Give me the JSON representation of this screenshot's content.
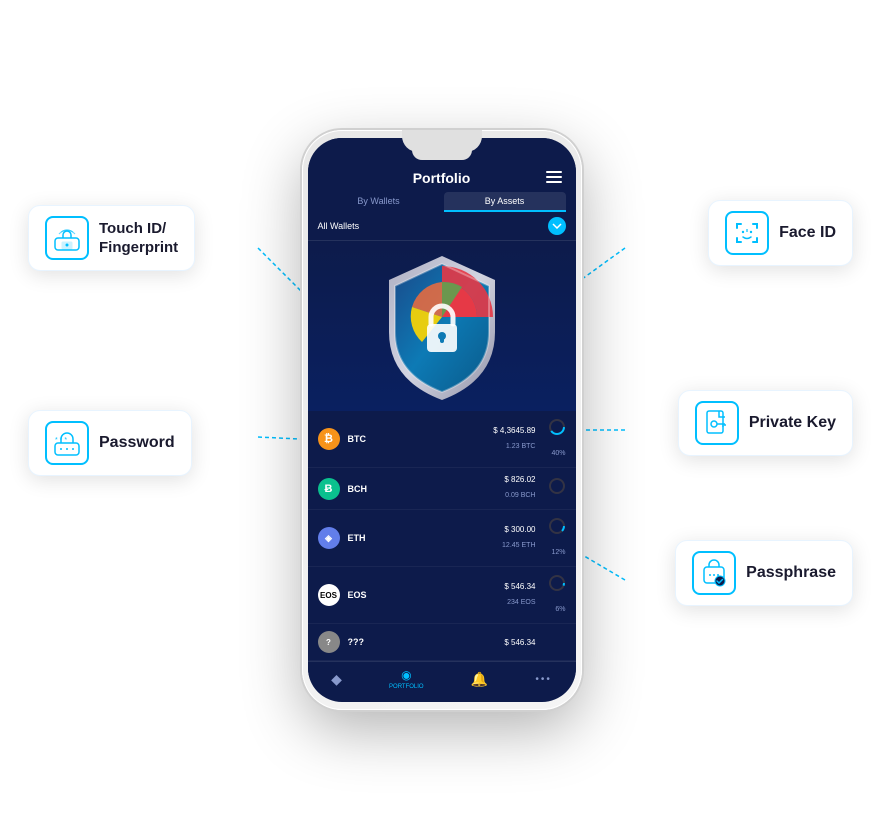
{
  "app": {
    "title": "Portfolio",
    "menu_icon": "☰"
  },
  "tabs": [
    {
      "label": "By Wallets",
      "active": false
    },
    {
      "label": "By Assets",
      "active": true
    }
  ],
  "wallet_selector": {
    "label": "All Wallets",
    "dropdown_icon": "▾"
  },
  "portfolio_items": [
    {
      "symbol": "BTC",
      "icon_type": "btc",
      "usd": "$ 4,3645.89",
      "amount": "1.23 BTC",
      "pct": "40%"
    },
    {
      "symbol": "BCH",
      "icon_type": "bch",
      "usd": "$ 826.02",
      "amount": "0.09 BCH",
      "pct": ""
    },
    {
      "symbol": "ETH",
      "icon_type": "eth",
      "usd": "$ 300.00",
      "amount": "12.45 ETH",
      "pct": "12%"
    },
    {
      "symbol": "EOS",
      "icon_type": "eos",
      "usd": "$ 546.34",
      "amount": "234 EOS",
      "pct": "6%"
    },
    {
      "symbol": "???",
      "icon_type": "other",
      "usd": "$ 546.34",
      "amount": "",
      "pct": ""
    }
  ],
  "bottom_nav": [
    {
      "label": "",
      "icon": "◆",
      "active": false
    },
    {
      "label": "PORTFOLIO",
      "icon": "◉",
      "active": true
    },
    {
      "label": "",
      "icon": "🔔",
      "active": false
    },
    {
      "label": "",
      "icon": "•••",
      "active": false
    }
  ],
  "features": {
    "touch_id": {
      "label": "Touch ID/\nFingerprint",
      "icon": "fingerprint"
    },
    "face_id": {
      "label": "Face ID",
      "icon": "face"
    },
    "password": {
      "label": "Password",
      "icon": "password"
    },
    "private_key": {
      "label": "Private Key",
      "icon": "key"
    },
    "passphrase": {
      "label": "Passphrase",
      "icon": "passphrase"
    }
  },
  "colors": {
    "accent": "#00bfff",
    "phone_bg": "#0d1b4b",
    "connector_line": "#00bfff",
    "label_text": "#1a1a2e"
  }
}
